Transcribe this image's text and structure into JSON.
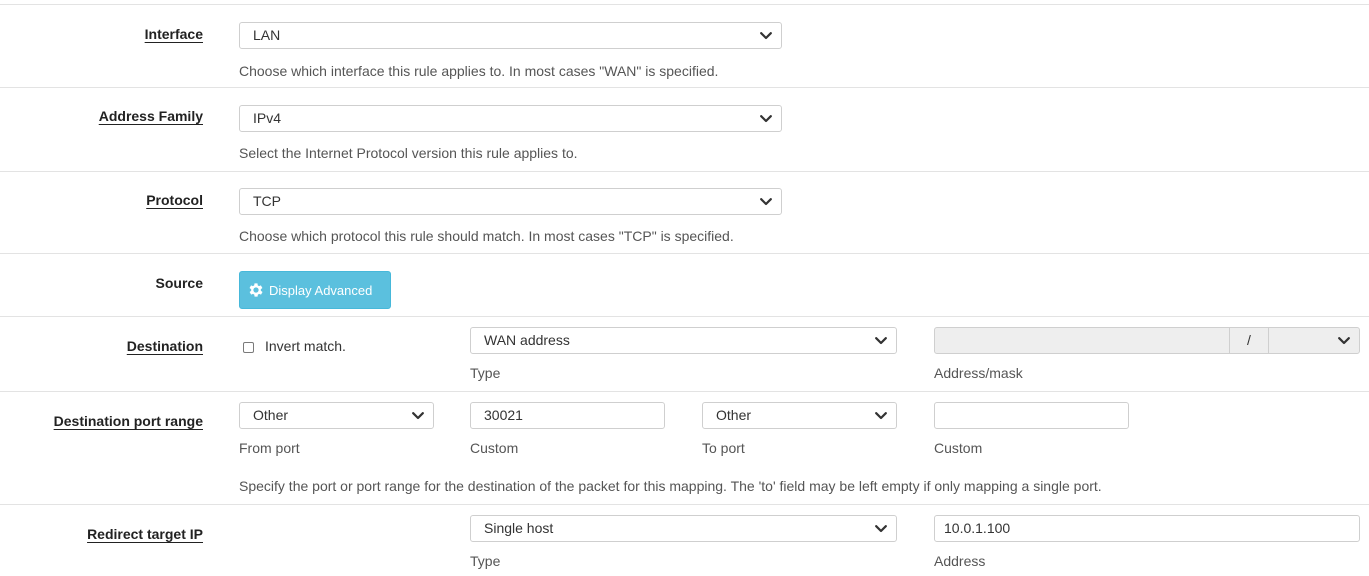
{
  "interface": {
    "label": "Interface",
    "value": "LAN",
    "help": "Choose which interface this rule applies to. In most cases \"WAN\" is specified."
  },
  "address_family": {
    "label": "Address Family",
    "value": "IPv4",
    "help": "Select the Internet Protocol version this rule applies to."
  },
  "protocol": {
    "label": "Protocol",
    "value": "TCP",
    "help": "Choose which protocol this rule should match. In most cases \"TCP\" is specified."
  },
  "source": {
    "label": "Source",
    "button_label": "Display Advanced",
    "button_icon": "gear-icon"
  },
  "destination": {
    "label": "Destination",
    "invert_label": "Invert match.",
    "invert_checked": false,
    "type_value": "WAN address",
    "type_caption": "Type",
    "address_value": "",
    "mask_separator": "/",
    "mask_value": "",
    "address_caption": "Address/mask"
  },
  "dest_port_range": {
    "label": "Destination port range",
    "from_value": "Other",
    "from_caption": "From port",
    "from_custom": "30021",
    "from_custom_caption": "Custom",
    "to_value": "Other",
    "to_caption": "To port",
    "to_custom": "",
    "to_custom_caption": "Custom",
    "help": "Specify the port or port range for the destination of the packet for this mapping. The 'to' field may be left empty if only mapping a single port."
  },
  "redirect_target": {
    "label": "Redirect target IP",
    "type_value": "Single host",
    "type_caption": "Type",
    "address_value": "10.0.1.100",
    "address_caption": "Address"
  },
  "colors": {
    "button_bg": "#5bc0de",
    "border": "#cfcfcf",
    "row_divider": "#e3e3e3"
  }
}
